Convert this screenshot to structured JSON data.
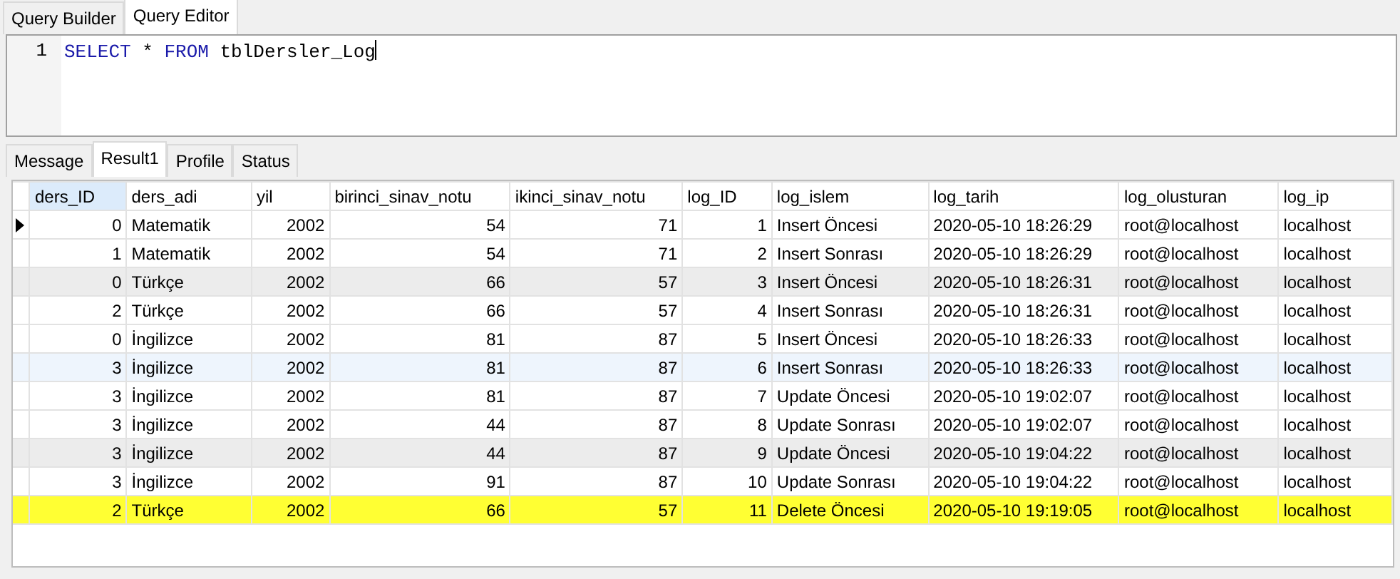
{
  "editor_tabs": [
    {
      "label": "Query Builder",
      "selected": false
    },
    {
      "label": "Query Editor",
      "selected": true
    }
  ],
  "editor": {
    "lines": [
      {
        "number": "1",
        "tokens": [
          {
            "kind": "keyword",
            "text": "SELECT"
          },
          {
            "kind": "plain",
            "text": " * "
          },
          {
            "kind": "keyword",
            "text": "FROM"
          },
          {
            "kind": "plain",
            "text": " tblDersler_Log"
          }
        ]
      }
    ]
  },
  "result_tabs": [
    {
      "label": "Message",
      "selected": false
    },
    {
      "label": "Result1",
      "selected": true
    },
    {
      "label": "Profile",
      "selected": false
    },
    {
      "label": "Status",
      "selected": false
    }
  ],
  "table": {
    "columns": [
      {
        "label": "ders_ID",
        "selected": true
      },
      {
        "label": "ders_adi",
        "selected": false
      },
      {
        "label": "yil",
        "selected": false
      },
      {
        "label": "birinci_sinav_notu",
        "selected": false
      },
      {
        "label": "ikinci_sinav_notu",
        "selected": false
      },
      {
        "label": "log_ID",
        "selected": false
      },
      {
        "label": "log_islem",
        "selected": false
      },
      {
        "label": "log_tarih",
        "selected": false
      },
      {
        "label": "log_olusturan",
        "selected": false
      },
      {
        "label": "log_ip",
        "selected": false
      }
    ],
    "rows": [
      {
        "selected": true,
        "kind": "plain",
        "cells": [
          "0",
          "Matematik",
          "2002",
          "54",
          "71",
          "1",
          "Insert Öncesi",
          "2020-05-10 18:26:29",
          "root@localhost",
          "localhost"
        ]
      },
      {
        "selected": false,
        "kind": "plain",
        "cells": [
          "1",
          "Matematik",
          "2002",
          "54",
          "71",
          "2",
          "Insert Sonrası",
          "2020-05-10 18:26:29",
          "root@localhost",
          "localhost"
        ]
      },
      {
        "selected": false,
        "kind": "shaded",
        "cells": [
          "0",
          "Türkçe",
          "2002",
          "66",
          "57",
          "3",
          "Insert Öncesi",
          "2020-05-10 18:26:31",
          "root@localhost",
          "localhost"
        ]
      },
      {
        "selected": false,
        "kind": "plain",
        "cells": [
          "2",
          "Türkçe",
          "2002",
          "66",
          "57",
          "4",
          "Insert Sonrası",
          "2020-05-10 18:26:31",
          "root@localhost",
          "localhost"
        ]
      },
      {
        "selected": false,
        "kind": "plain",
        "cells": [
          "0",
          "İngilizce",
          "2002",
          "81",
          "87",
          "5",
          "Insert Öncesi",
          "2020-05-10 18:26:33",
          "root@localhost",
          "localhost"
        ]
      },
      {
        "selected": false,
        "kind": "hover",
        "cells": [
          "3",
          "İngilizce",
          "2002",
          "81",
          "87",
          "6",
          "Insert Sonrası",
          "2020-05-10 18:26:33",
          "root@localhost",
          "localhost"
        ]
      },
      {
        "selected": false,
        "kind": "plain",
        "cells": [
          "3",
          "İngilizce",
          "2002",
          "81",
          "87",
          "7",
          "Update Öncesi",
          "2020-05-10 19:02:07",
          "root@localhost",
          "localhost"
        ]
      },
      {
        "selected": false,
        "kind": "plain",
        "cells": [
          "3",
          "İngilizce",
          "2002",
          "44",
          "87",
          "8",
          "Update Sonrası",
          "2020-05-10 19:02:07",
          "root@localhost",
          "localhost"
        ]
      },
      {
        "selected": false,
        "kind": "shaded",
        "cells": [
          "3",
          "İngilizce",
          "2002",
          "44",
          "87",
          "9",
          "Update Öncesi",
          "2020-05-10 19:04:22",
          "root@localhost",
          "localhost"
        ]
      },
      {
        "selected": false,
        "kind": "plain",
        "cells": [
          "3",
          "İngilizce",
          "2002",
          "91",
          "87",
          "10",
          "Update Sonrası",
          "2020-05-10 19:04:22",
          "root@localhost",
          "localhost"
        ]
      },
      {
        "selected": false,
        "kind": "marked",
        "cells": [
          "2",
          "Türkçe",
          "2002",
          "66",
          "57",
          "11",
          "Delete Öncesi",
          "2020-05-10 19:19:05",
          "root@localhost",
          "localhost"
        ]
      }
    ]
  }
}
